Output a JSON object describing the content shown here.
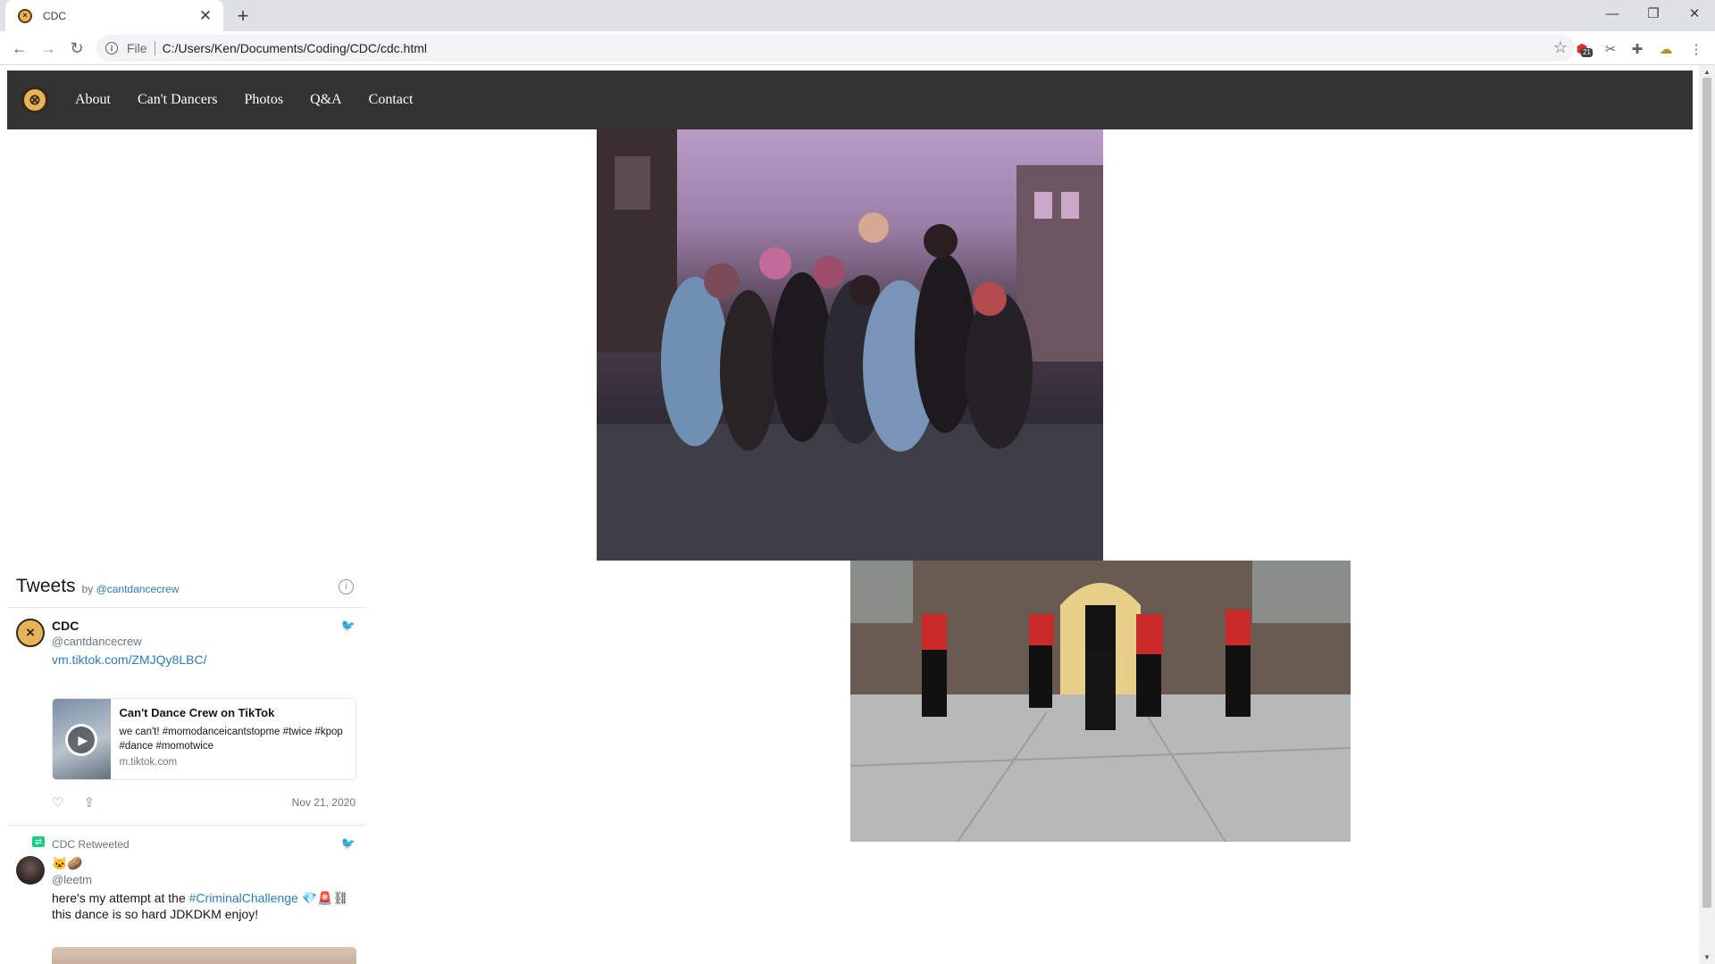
{
  "browser": {
    "tab_title": "CDC",
    "new_tab_symbol": "+",
    "scheme_label": "File",
    "url": "C:/Users/Ken/Documents/Coding/CDC/cdc.html",
    "extension_badge": "21"
  },
  "site": {
    "nav": {
      "logo_glyph": "⊗",
      "links": [
        "About",
        "Can't Dancers",
        "Photos",
        "Q&A",
        "Contact"
      ]
    },
    "photos": [
      {
        "name": "group-photo-street"
      },
      {
        "name": "group-photo-courtyard"
      }
    ]
  },
  "twitter": {
    "header_title": "Tweets",
    "header_by": "by",
    "header_handle": "@cantdancecrew",
    "tweets": [
      {
        "name": "CDC",
        "handle": "@cantdancecrew",
        "link": "vm.tiktok.com/ZMJQy8LBC/",
        "card": {
          "title": "Can't Dance Crew on TikTok",
          "description": "we can't! #momodanceicantstopme #twice #kpop #dance #momotwice",
          "domain": "m.tiktok.com"
        },
        "date": "Nov 21, 2020"
      },
      {
        "retweet_label": "CDC Retweeted",
        "name": "🐱🥔",
        "handle": "@leetm",
        "text_before": "here's my attempt at the ",
        "hashtag": "#CriminalChallenge",
        "emojis": " 💎🚨⛓",
        "text_after": "this dance is so hard JDKDKM enjoy!"
      }
    ]
  },
  "colors": {
    "navbar": "#333333",
    "link": "#2b7bb9",
    "retweet": "#19cf86"
  },
  "icons": [
    "info-icon",
    "back-arrow-icon",
    "forward-arrow-icon",
    "reload-icon",
    "star-icon",
    "extension-icon",
    "twitter-bird-icon",
    "heart-icon",
    "share-icon",
    "play-icon",
    "retweet-icon"
  ]
}
